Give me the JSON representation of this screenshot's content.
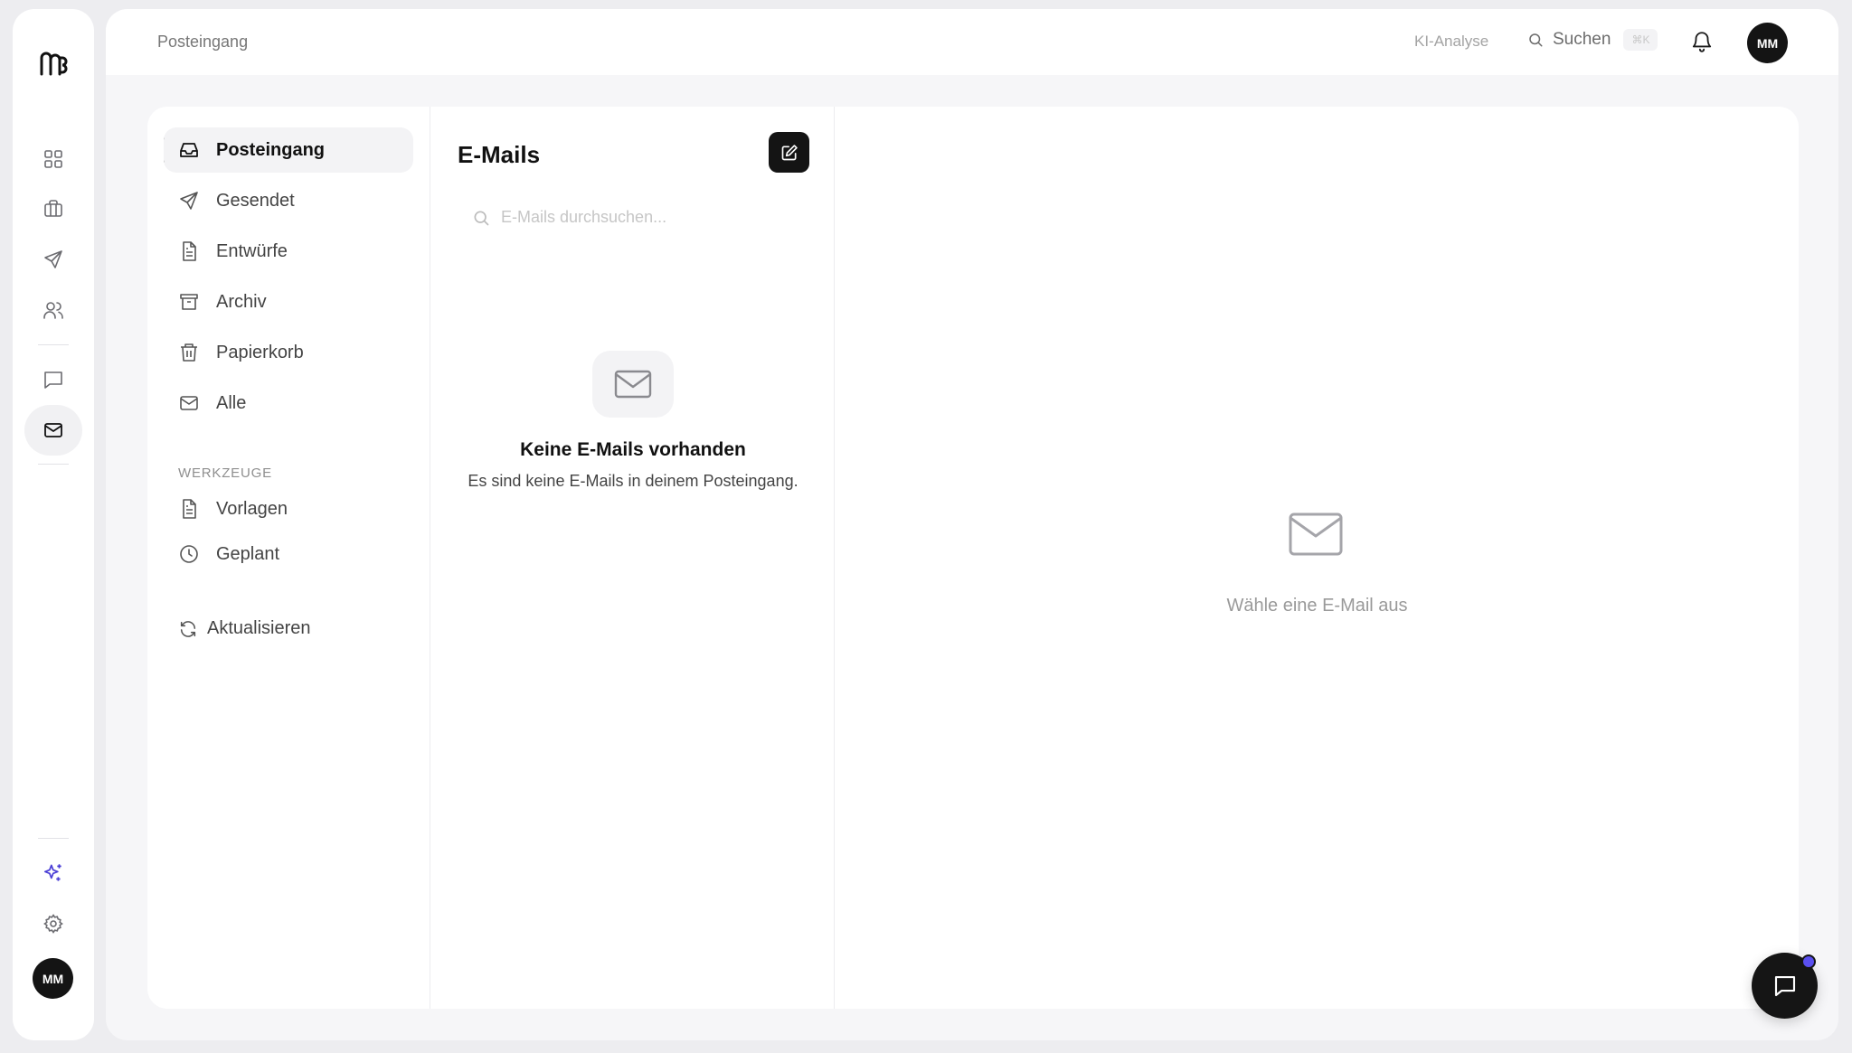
{
  "rail": {
    "items": [
      {
        "icon": "grid-icon",
        "active": false
      },
      {
        "icon": "briefcase-icon",
        "active": false
      },
      {
        "icon": "send-icon",
        "active": false
      },
      {
        "icon": "users-icon",
        "active": false
      },
      {
        "icon": "message-square-icon",
        "active": false
      },
      {
        "icon": "mail-icon",
        "active": true
      },
      {
        "icon": "sparkles-icon",
        "active": false
      },
      {
        "icon": "gear-icon",
        "active": false
      }
    ],
    "avatar_initials": "MM"
  },
  "topbar": {
    "breadcrumb": "Posteingang",
    "ai_label": "KI-Analyse",
    "search_label": "Suchen",
    "search_shortcut": "⌘K",
    "avatar_initials": "MM"
  },
  "folders": {
    "items": [
      {
        "label": "Posteingang",
        "icon": "inbox-icon",
        "active": true
      },
      {
        "label": "Gesendet",
        "icon": "send-icon",
        "active": false
      },
      {
        "label": "Entwürfe",
        "icon": "file-text-icon",
        "active": false
      },
      {
        "label": "Archiv",
        "icon": "archive-icon",
        "active": false
      },
      {
        "label": "Papierkorb",
        "icon": "trash-icon",
        "active": false
      },
      {
        "label": "Alle",
        "icon": "mail-icon",
        "active": false
      }
    ],
    "tools_label": "WERKZEUGE",
    "tools": [
      {
        "label": "Vorlagen",
        "icon": "file-text-icon"
      },
      {
        "label": "Geplant",
        "icon": "clock-icon"
      }
    ],
    "refresh_label": "Aktualisieren"
  },
  "list": {
    "title": "E-Mails",
    "search_placeholder": "E-Mails durchsuchen...",
    "empty_title": "Keine E-Mails vorhanden",
    "empty_subtitle": "Es sind keine E-Mails in deinem Posteingang."
  },
  "detail": {
    "hint": "Wähle eine E-Mail aus"
  },
  "colors": {
    "accent": "#5a4ff0",
    "dark": "#141414"
  }
}
